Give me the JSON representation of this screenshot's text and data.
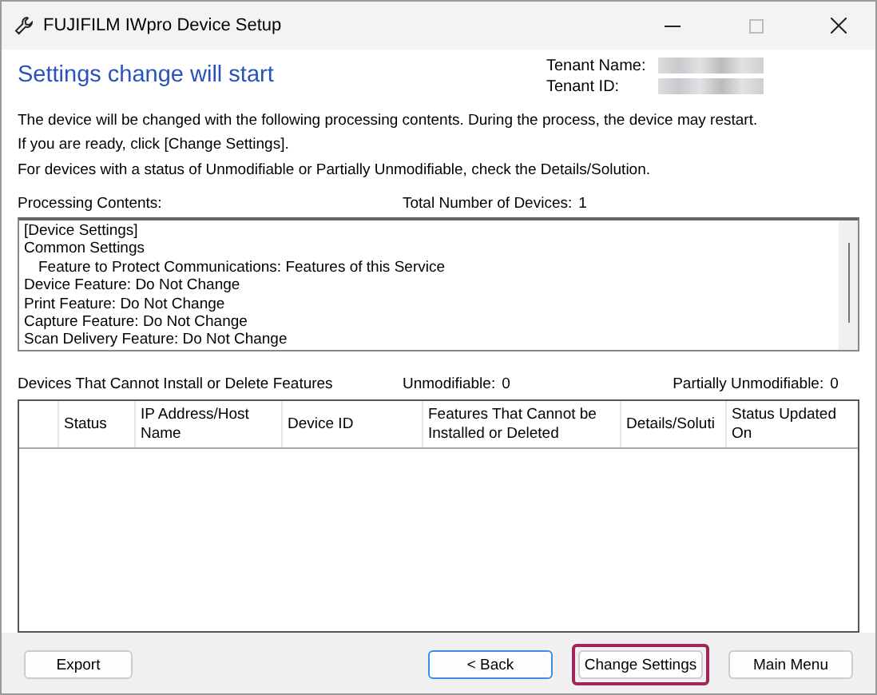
{
  "window": {
    "title": "FUJIFILM IWpro Device Setup"
  },
  "heading": "Settings change will start",
  "tenant": [
    {
      "label": "Tenant Name:"
    },
    {
      "label": "Tenant ID:"
    }
  ],
  "description": [
    "The device will be changed with the following processing contents. During the process, the device may restart.",
    "If you are ready, click [Change Settings].",
    "For devices with a status of Unmodifiable or Partially Unmodifiable, check the Details/Solution."
  ],
  "processing": {
    "label": "Processing Contents:",
    "total_label": "Total Number of Devices:",
    "total": "1",
    "lines": [
      {
        "text": "[Device Settings]"
      },
      {
        "text": "Common Settings",
        "children": [
          {
            "text": "Feature to Protect Communications: Features of this Service"
          }
        ]
      },
      {
        "text": "Device Feature: Do Not Change"
      },
      {
        "text": "Print Feature: Do Not Change"
      },
      {
        "text": "Capture Feature: Do Not Change"
      },
      {
        "text": "Scan Delivery Feature: Do Not Change"
      }
    ]
  },
  "devices": {
    "label": "Devices That Cannot Install or Delete Features",
    "unmodifiable_label": "Unmodifiable:",
    "unmodifiable": "0",
    "partial_label": "Partially Unmodifiable:",
    "partial": "0",
    "columns": [
      "Status",
      "IP Address/Host Name",
      "Device ID",
      "Features That Cannot be Installed or Deleted",
      "Details/Soluti",
      "Status Updated On"
    ]
  },
  "buttons": [
    {
      "label": "Export",
      "focused": false,
      "highlighted": false
    },
    {
      "label": "< Back",
      "focused": true,
      "highlighted": false
    },
    {
      "label": "Change Settings",
      "focused": false,
      "highlighted": true
    },
    {
      "label": "Main Menu",
      "focused": false,
      "highlighted": false
    }
  ]
}
